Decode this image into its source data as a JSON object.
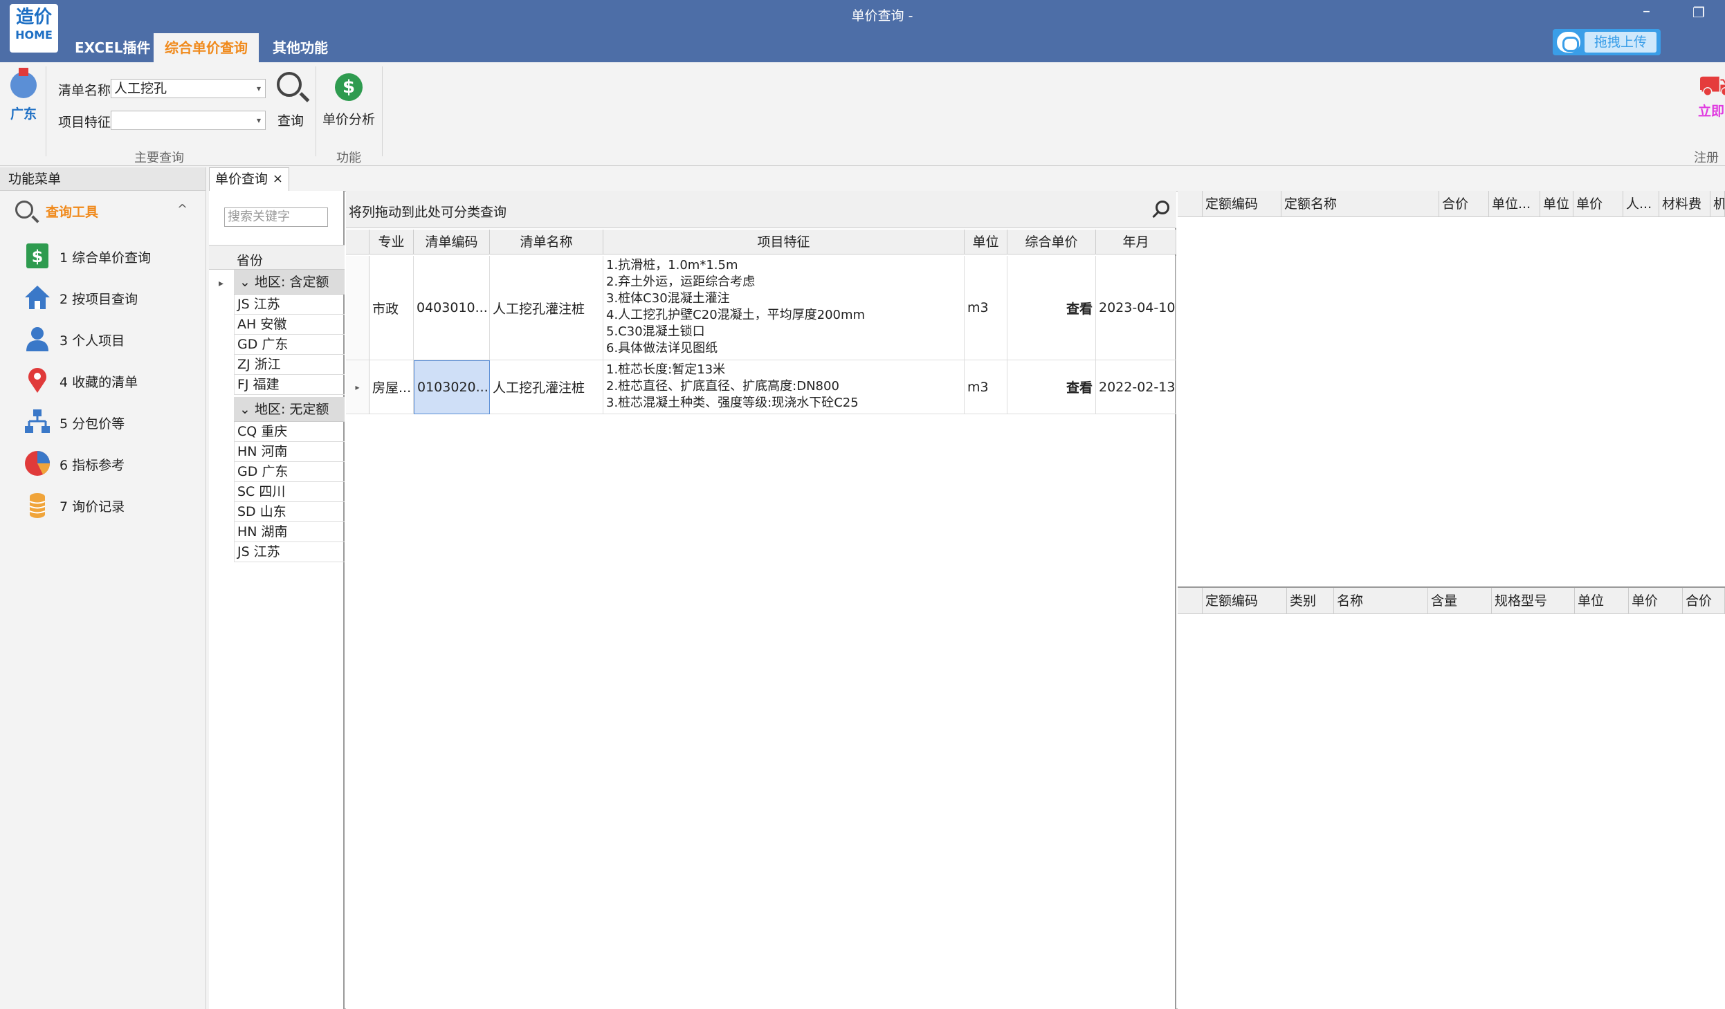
{
  "window": {
    "title": "单价查询 -",
    "minimize": "–",
    "restore": "❐"
  },
  "logo": {
    "line1": "造价",
    "line2": "HOME"
  },
  "menu_tabs": [
    "EXCEL插件",
    "综合单价查询",
    "其他功能"
  ],
  "upload": {
    "label": "拖拽上传"
  },
  "ribbon": {
    "region_button": "广东",
    "list_name_label": "清单名称",
    "list_name_value": "人工挖孔",
    "feature_label": "项目特征",
    "feature_value": "",
    "search_button": "查询",
    "group_main": "主要查询",
    "analysis_button": "单价分析",
    "group_func": "功能",
    "buy_button": "立即",
    "register_label": "注册",
    "dropdown_arrow": "▾"
  },
  "sidebar": {
    "header": "功能菜单",
    "group": "查询工具",
    "chevron": "^",
    "items": [
      {
        "label": "1 综合单价查询",
        "icon": "dollar-book-icon"
      },
      {
        "label": "2 按项目查询",
        "icon": "house-icon"
      },
      {
        "label": "3 个人项目",
        "icon": "person-icon"
      },
      {
        "label": "4 收藏的清单",
        "icon": "map-pin-icon"
      },
      {
        "label": "5 分包价等",
        "icon": "org-chart-icon"
      },
      {
        "label": "6 指标参考",
        "icon": "pie-chart-icon"
      },
      {
        "label": "7 询价记录",
        "icon": "coins-icon"
      }
    ]
  },
  "doc_tab": {
    "label": "单价查询",
    "close": "×"
  },
  "province": {
    "search_placeholder": "搜索关键字",
    "header": "省份",
    "expander": "▸",
    "groups": [
      {
        "label": "地区: 含定额",
        "rows": [
          "JS 江苏",
          "AH 安徽",
          "GD 广东",
          "ZJ 浙江",
          "FJ 福建"
        ]
      },
      {
        "label": "地区: 无定额",
        "rows": [
          "CQ 重庆",
          "HN 河南",
          "GD 广东",
          "SC 四川",
          "SD 山东",
          "HN 湖南",
          "JS 江苏"
        ]
      }
    ],
    "group_chevron": "⌄"
  },
  "grid": {
    "group_hint": "将列拖动到此处可分类查询",
    "columns": [
      "专业",
      "清单编码",
      "清单名称",
      "项目特征",
      "单位",
      "综合单价",
      "年月"
    ],
    "row_marker": "▸",
    "rows": [
      {
        "major": "市政",
        "code": "0403010...",
        "name": "人工挖孔灌注桩",
        "features": [
          "1.抗滑桩，1.0m*1.5m",
          "2.弃土外运，运距综合考虑",
          "3.桩体C30混凝土灌注",
          "4.人工挖孔护壁C20混凝土，平均厚度200mm",
          "5.C30混凝土锁口",
          "6.具体做法详见图纸"
        ],
        "unit": "m3",
        "price": "查看",
        "date": "2023-04-10"
      },
      {
        "major": "房屋...",
        "code": "0103020...",
        "name": "人工挖孔灌注桩",
        "features": [
          "1.桩芯长度:暂定13米",
          "2.桩芯直径、扩底直径、扩底高度:DN800",
          "3.桩芯混凝土种类、强度等级:现浇水下砼C25"
        ],
        "unit": "m3",
        "price": "查看",
        "date": "2022-02-13"
      }
    ]
  },
  "right_top": {
    "columns": [
      "定额编码",
      "定额名称",
      "合价",
      "单位...",
      "单位",
      "单价",
      "人...",
      "材料费",
      "机"
    ]
  },
  "right_bottom": {
    "columns": [
      "定额编码",
      "类别",
      "名称",
      "含量",
      "规格型号",
      "单位",
      "单价",
      "合价"
    ]
  },
  "colors": {
    "titlebar": "#4d6ea7",
    "accent": "#f08a1c",
    "selection": "#cfdff7"
  }
}
